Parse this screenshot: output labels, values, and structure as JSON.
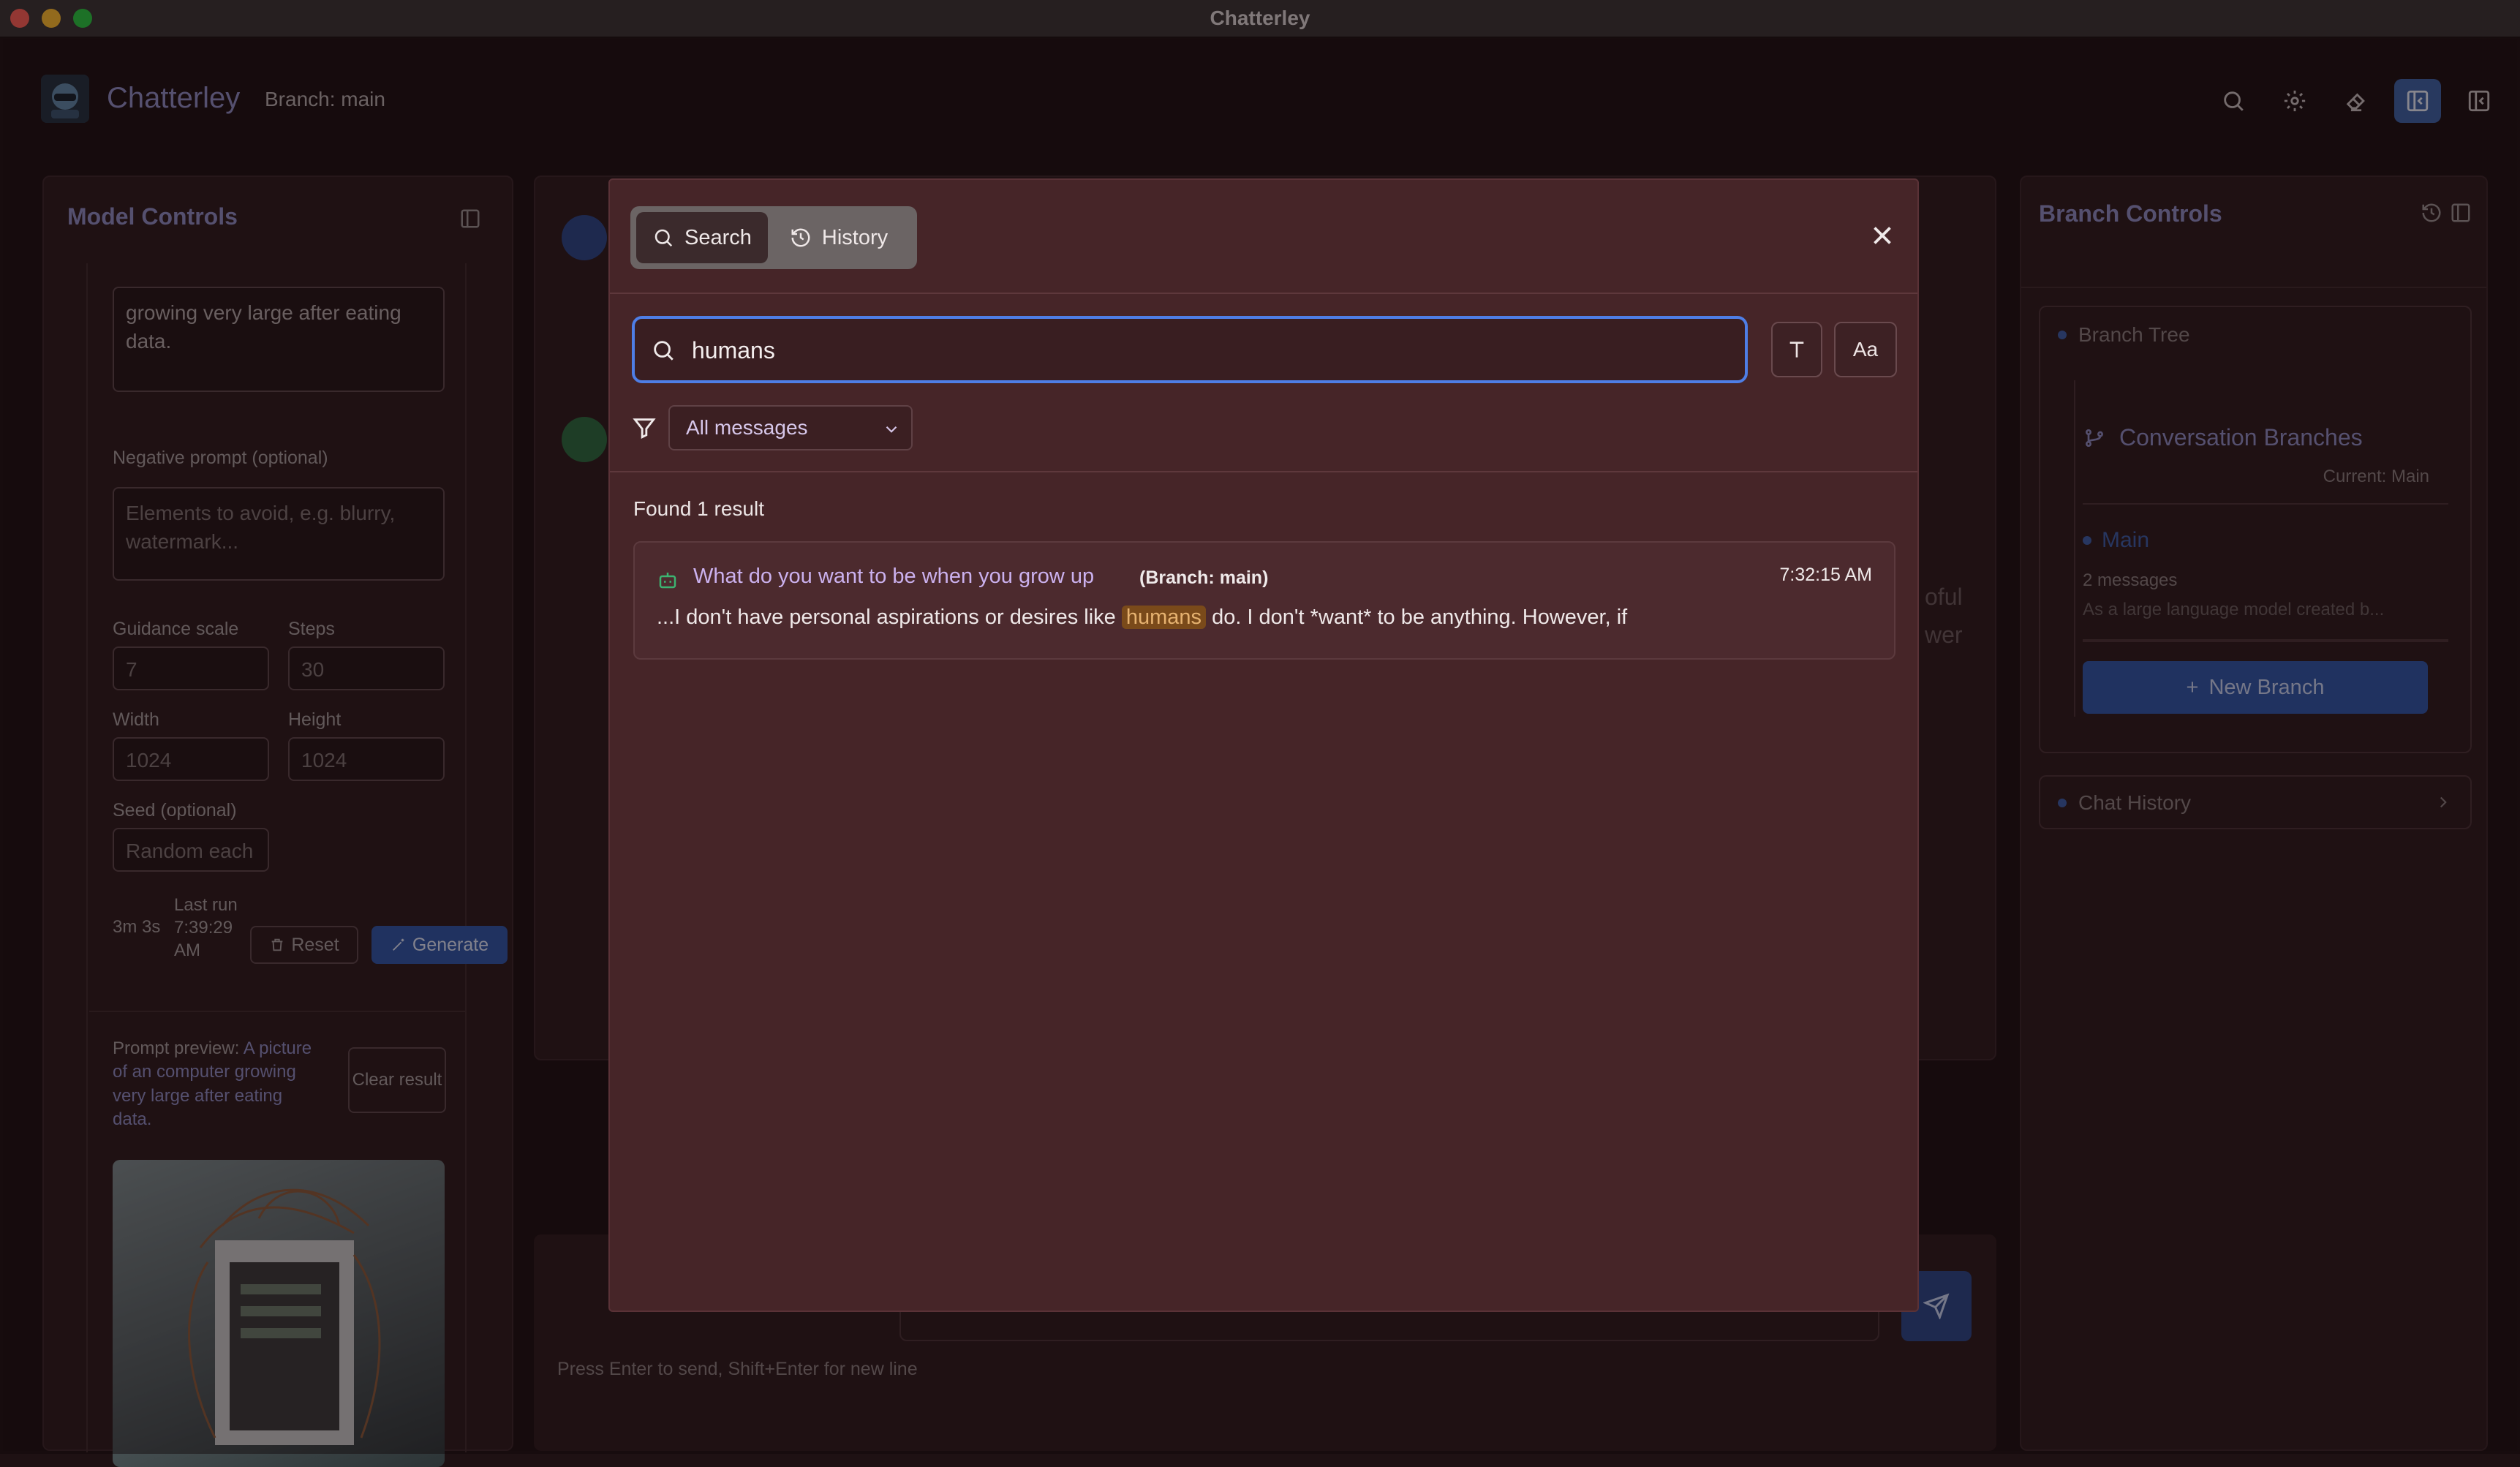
{
  "window": {
    "title": "Chatterley"
  },
  "header": {
    "app_name": "Chatterley",
    "branch_label": "Branch: main"
  },
  "left_panel": {
    "title": "Model Controls",
    "prompt_text": "growing very large after eating data.",
    "negative_label": "Negative prompt (optional)",
    "negative_placeholder": "Elements to avoid, e.g. blurry, watermark...",
    "guidance_label": "Guidance scale",
    "guidance_value": "7",
    "steps_label": "Steps",
    "steps_value": "30",
    "width_label": "Width",
    "width_value": "1024",
    "height_label": "Height",
    "height_value": "1024",
    "seed_label": "Seed (optional)",
    "seed_placeholder": "Random each",
    "duration": "3m 3s",
    "last_run": "Last run 7:39:29 AM",
    "reset_label": "Reset",
    "generate_label": "Generate",
    "preview_label": "Prompt preview:",
    "preview_text": "A picture of an computer growing very large after eating data.",
    "clear_label": "Clear result"
  },
  "chat": {
    "fragment_1": "oful",
    "fragment_2": "wer",
    "hint": "Press Enter to send, Shift+Enter for new line"
  },
  "right_panel": {
    "title": "Branch Controls",
    "tree_label": "Branch Tree",
    "branches_title": "Conversation Branches",
    "current": "Current: Main",
    "branch_name": "Main",
    "branch_count": "2 messages",
    "branch_preview": "As a large language model created b...",
    "new_branch": "New Branch",
    "chat_history": "Chat History"
  },
  "modal": {
    "tabs": [
      {
        "label": "Search"
      },
      {
        "label": "History"
      }
    ],
    "query": "humans",
    "case_button": "Aa",
    "filter_value": "All messages",
    "found_text": "Found 1 result",
    "results": [
      {
        "title": "What do you want to be when you grow up",
        "branch": "(Branch: main)",
        "time": "7:32:15 AM",
        "snippet_before": "...I don't have personal aspirations or desires like",
        "snippet_match": "humans",
        "snippet_after": "do. I don't *want* to be anything. However, if"
      }
    ]
  },
  "colors": {
    "accent": "#4e7ee6",
    "primary_button": "#2e56a8",
    "modal_bg": "#462528",
    "highlight_bg": "#7a4a1a",
    "highlight_text": "#e6b270",
    "result_title": "#cbb1ee"
  }
}
